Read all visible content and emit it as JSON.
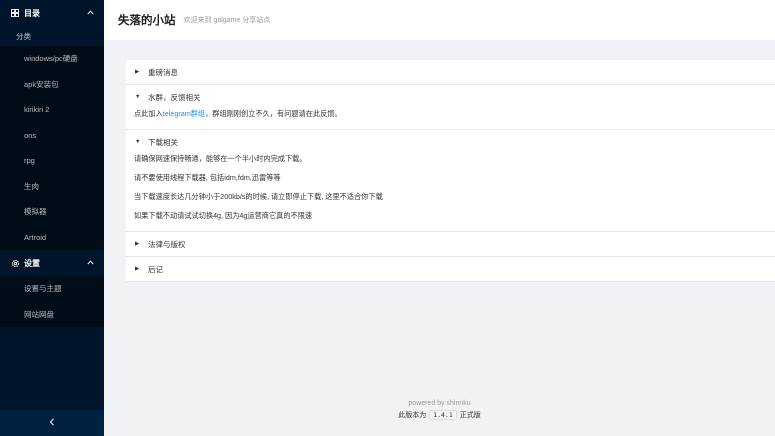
{
  "sidebar": {
    "catalog": {
      "label": "目录",
      "icon": "grid-icon"
    },
    "category_label": "分类",
    "items": [
      "windows/pc硬盘",
      "apk安装包",
      "kirikiri 2",
      "ons",
      "rpg",
      "生肉",
      "模拟器",
      "Artroid"
    ],
    "settings": {
      "label": "设置",
      "icon": "gear-icon"
    },
    "settings_items": [
      "设置与主题",
      "网站网盘"
    ],
    "collapse_icon": "chevron-left-icon"
  },
  "header": {
    "title": "失落的小站",
    "subtitle": "欢迎来到 galgame 分享站点"
  },
  "panels": {
    "p1": {
      "title": "重磅消息"
    },
    "p2": {
      "title": "水群，反馈相关",
      "line_pre": "点此加入",
      "link": "telegram群组",
      "line_post": "，群组刚刚创立不久，有问题请在此反馈。"
    },
    "p3": {
      "title": "下载相关",
      "lines": [
        "请确保网速保持畅通，能够在一个半小时内完成下载。",
        "请不要使用线程下载器, 包括idm,fdm,迅雷等等",
        "当下载速度长达几分钟小于200kb/s的时候, 请立即停止下载, 这里不适合你下载",
        "如果下载不动请试试切换4g, 因为4g运营商它真的不限速"
      ]
    },
    "p4": {
      "title": "法律与版权"
    },
    "p5": {
      "title": "后记"
    }
  },
  "footer": {
    "powered": "powered by shinnku",
    "version_pre": "此版本为",
    "version": "1.4.1",
    "version_post": "正式版"
  }
}
